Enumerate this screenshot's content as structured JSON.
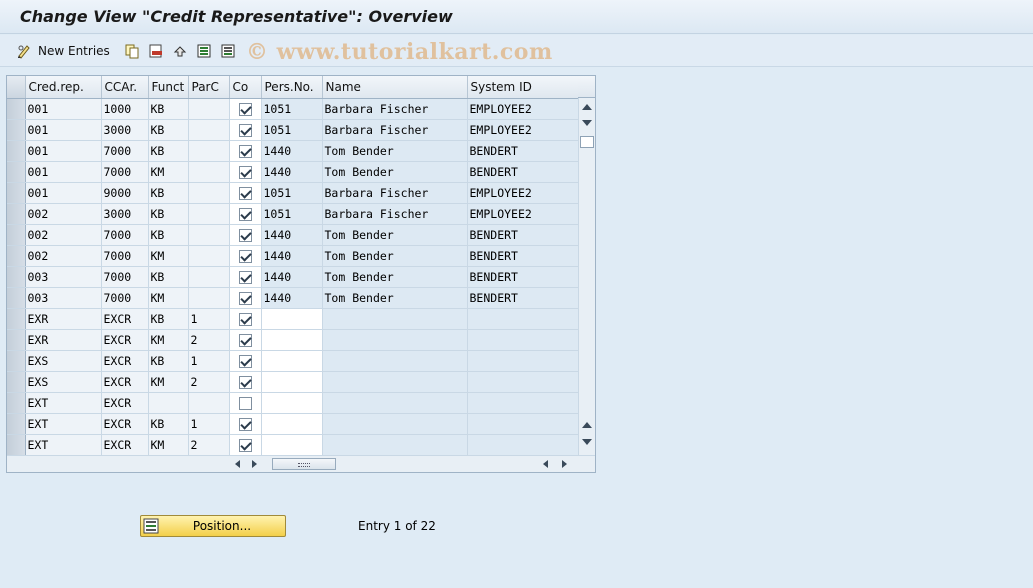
{
  "title": "Change View \"Credit Representative\": Overview",
  "toolbar": {
    "new_entries_label": "New Entries",
    "icons": [
      "edit-glasses-icon",
      "copy-icon",
      "delete-icon",
      "undo-icon",
      "select-all-icon",
      "deselect-icon"
    ]
  },
  "watermark": "© www.tutorialkart.com",
  "table": {
    "columns": [
      "Cred.rep.",
      "CCAr.",
      "Funct",
      "ParC",
      "Co",
      "Pers.No.",
      "Name",
      "System ID"
    ],
    "rows": [
      {
        "credrep": "001",
        "ccar": "1000",
        "funct": "KB",
        "parc": "",
        "co": true,
        "persno": "1051",
        "name": "Barbara Fischer",
        "sysid": "EMPLOYEE2"
      },
      {
        "credrep": "001",
        "ccar": "3000",
        "funct": "KB",
        "parc": "",
        "co": true,
        "persno": "1051",
        "name": "Barbara Fischer",
        "sysid": "EMPLOYEE2"
      },
      {
        "credrep": "001",
        "ccar": "7000",
        "funct": "KB",
        "parc": "",
        "co": true,
        "persno": "1440",
        "name": "Tom Bender",
        "sysid": "BENDERT"
      },
      {
        "credrep": "001",
        "ccar": "7000",
        "funct": "KM",
        "parc": "",
        "co": true,
        "persno": "1440",
        "name": "Tom Bender",
        "sysid": "BENDERT"
      },
      {
        "credrep": "001",
        "ccar": "9000",
        "funct": "KB",
        "parc": "",
        "co": true,
        "persno": "1051",
        "name": "Barbara Fischer",
        "sysid": "EMPLOYEE2"
      },
      {
        "credrep": "002",
        "ccar": "3000",
        "funct": "KB",
        "parc": "",
        "co": true,
        "persno": "1051",
        "name": "Barbara Fischer",
        "sysid": "EMPLOYEE2"
      },
      {
        "credrep": "002",
        "ccar": "7000",
        "funct": "KB",
        "parc": "",
        "co": true,
        "persno": "1440",
        "name": "Tom Bender",
        "sysid": "BENDERT"
      },
      {
        "credrep": "002",
        "ccar": "7000",
        "funct": "KM",
        "parc": "",
        "co": true,
        "persno": "1440",
        "name": "Tom Bender",
        "sysid": "BENDERT"
      },
      {
        "credrep": "003",
        "ccar": "7000",
        "funct": "KB",
        "parc": "",
        "co": true,
        "persno": "1440",
        "name": "Tom Bender",
        "sysid": "BENDERT"
      },
      {
        "credrep": "003",
        "ccar": "7000",
        "funct": "KM",
        "parc": "",
        "co": true,
        "persno": "1440",
        "name": "Tom Bender",
        "sysid": "BENDERT"
      },
      {
        "credrep": "EXR",
        "ccar": "EXCR",
        "funct": "KB",
        "parc": "1",
        "co": true,
        "persno": "",
        "name": "",
        "sysid": ""
      },
      {
        "credrep": "EXR",
        "ccar": "EXCR",
        "funct": "KM",
        "parc": "2",
        "co": true,
        "persno": "",
        "name": "",
        "sysid": ""
      },
      {
        "credrep": "EXS",
        "ccar": "EXCR",
        "funct": "KB",
        "parc": "1",
        "co": true,
        "persno": "",
        "name": "",
        "sysid": ""
      },
      {
        "credrep": "EXS",
        "ccar": "EXCR",
        "funct": "KM",
        "parc": "2",
        "co": true,
        "persno": "",
        "name": "",
        "sysid": ""
      },
      {
        "credrep": "EXT",
        "ccar": "EXCR",
        "funct": "",
        "parc": "",
        "co": false,
        "persno": "",
        "name": "",
        "sysid": ""
      },
      {
        "credrep": "EXT",
        "ccar": "EXCR",
        "funct": "KB",
        "parc": "1",
        "co": true,
        "persno": "",
        "name": "",
        "sysid": ""
      },
      {
        "credrep": "EXT",
        "ccar": "EXCR",
        "funct": "KM",
        "parc": "2",
        "co": true,
        "persno": "",
        "name": "",
        "sysid": ""
      }
    ]
  },
  "footer": {
    "position_label": "Position...",
    "entry_text": "Entry 1 of 22"
  },
  "colors": {
    "background": "#dfebf5",
    "button_yellow": "#f3cf4a",
    "watermark": "#deaa6e"
  }
}
